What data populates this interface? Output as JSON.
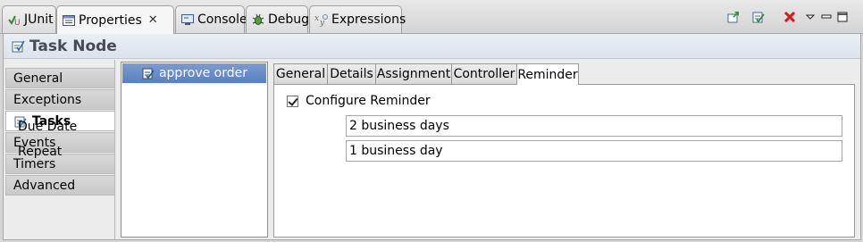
{
  "view_tabs": [
    {
      "label": "JUnit",
      "icon": "junit-icon"
    },
    {
      "label": "Properties",
      "icon": "properties-icon",
      "active": true
    },
    {
      "label": "Console",
      "icon": "console-icon"
    },
    {
      "label": "Debug",
      "icon": "debug-icon"
    },
    {
      "label": "Expressions",
      "icon": "expressions-icon"
    }
  ],
  "toolbar_icons": [
    "pin-icon",
    "edit-icon",
    "remove-icon",
    "view-menu-icon",
    "minimize-icon",
    "maximize-icon"
  ],
  "page": {
    "title": "Task Node",
    "icon": "task-node-icon"
  },
  "sections": [
    {
      "label": "General"
    },
    {
      "label": "Exceptions"
    },
    {
      "label": "Tasks",
      "active": true,
      "icon": "tasks-icon"
    },
    {
      "label": "Events"
    },
    {
      "label": "Timers"
    },
    {
      "label": "Advanced"
    }
  ],
  "tasks": [
    {
      "label": "approve order",
      "icon": "task-icon",
      "selected": true
    }
  ],
  "detail_tabs": [
    {
      "label": "General"
    },
    {
      "label": "Details"
    },
    {
      "label": "Assignment"
    },
    {
      "label": "Controller"
    },
    {
      "label": "Reminder",
      "active": true
    }
  ],
  "reminder": {
    "configure_label": "Configure Reminder",
    "configure_checked": true,
    "due_date_label": "Due Date",
    "due_date_value": "2 business days",
    "repeat_label": "Repeat",
    "repeat_value": "1 business day"
  },
  "colors": {
    "selection": "#6a8fcc",
    "remove": "#d91818",
    "accent": "#2d6fb8"
  }
}
